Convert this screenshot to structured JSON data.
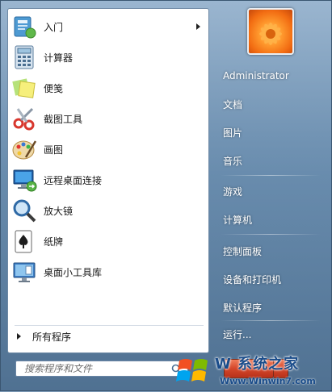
{
  "programs": [
    {
      "label": "入门",
      "icon": "getting-started-icon",
      "has_submenu": true
    },
    {
      "label": "计算器",
      "icon": "calculator-icon"
    },
    {
      "label": "便笺",
      "icon": "sticky-notes-icon"
    },
    {
      "label": "截图工具",
      "icon": "snipping-tool-icon"
    },
    {
      "label": "画图",
      "icon": "paint-icon"
    },
    {
      "label": "远程桌面连接",
      "icon": "remote-desktop-icon"
    },
    {
      "label": "放大镜",
      "icon": "magnifier-icon"
    },
    {
      "label": "纸牌",
      "icon": "solitaire-icon"
    },
    {
      "label": "桌面小工具库",
      "icon": "gadgets-icon"
    }
  ],
  "all_programs": "所有程序",
  "search": {
    "placeholder": "搜索程序和文件"
  },
  "right_panel": {
    "user": "Administrator",
    "items": [
      "文档",
      "图片",
      "音乐",
      "游戏",
      "计算机",
      "控制面板",
      "设备和打印机",
      "默认程序",
      "运行..."
    ]
  },
  "watermark": {
    "brand": "W 系统之家",
    "url": "Www.Winwin7.com"
  },
  "colors": {
    "accent": "#1a4c8a",
    "panel_bg": "#ffffff",
    "shutdown": "#d4462a"
  }
}
